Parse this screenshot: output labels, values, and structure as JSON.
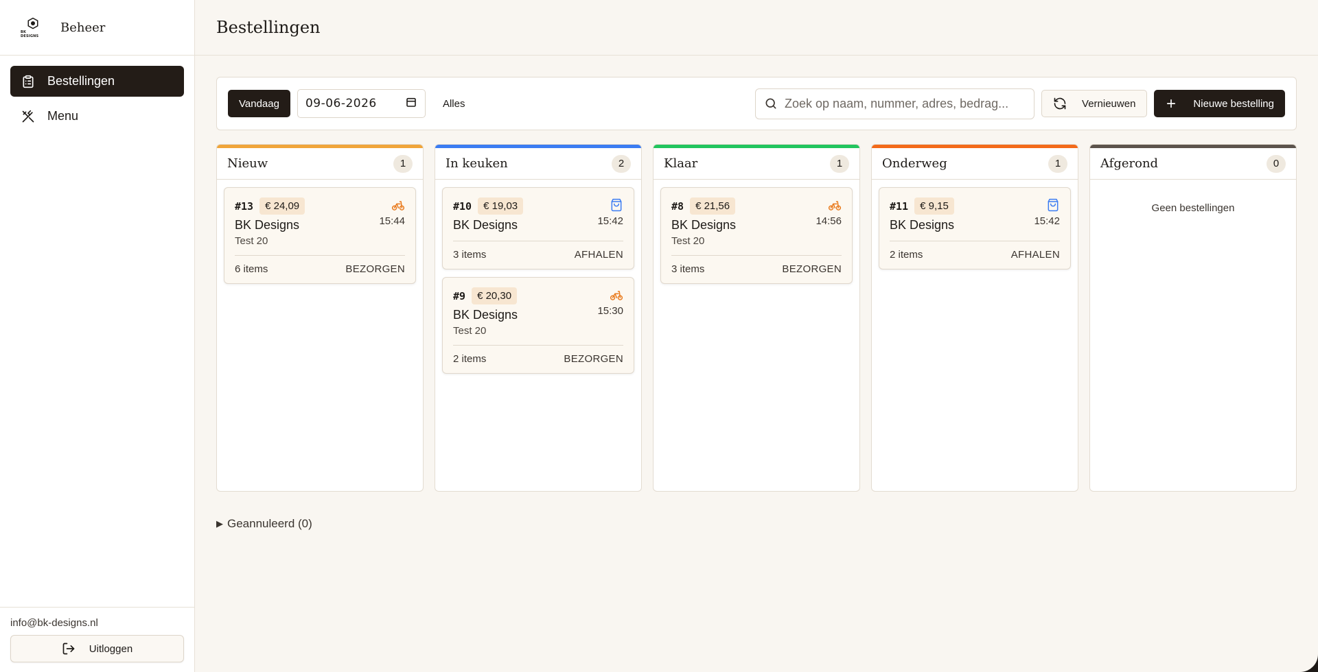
{
  "sidebar": {
    "brand_title": "Beheer",
    "logo_text": "BK DESIGNS",
    "nav": [
      {
        "label": "Bestellingen",
        "icon": "clipboard-icon",
        "active": true
      },
      {
        "label": "Menu",
        "icon": "utensils-icon",
        "active": false
      }
    ],
    "email": "info@bk-designs.nl",
    "logout_label": "Uitloggen"
  },
  "header": {
    "title": "Bestellingen"
  },
  "toolbar": {
    "today_label": "Vandaag",
    "date_value": "09-06-2026",
    "all_label": "Alles",
    "search_placeholder": "Zoek op naam, nummer, adres, bedrag...",
    "refresh_label": "Vernieuwen",
    "new_order_label": "Nieuwe bestelling"
  },
  "colors": {
    "nieuw": "#f0a53a",
    "in_keuken": "#3b7cf2",
    "klaar": "#22c55e",
    "onderweg": "#f36a1a",
    "afgerond": "#5c534c",
    "delivery_icon": "#e97a1c",
    "pickup_icon": "#3b7cf2"
  },
  "columns": [
    {
      "title": "Nieuw",
      "count": "1",
      "cards": [
        {
          "number": "#13",
          "price": "€ 24,09",
          "icon": "bike-icon",
          "time": "15:44",
          "name": "BK Designs",
          "sub": "Test 20",
          "items": "6 items",
          "type": "BEZORGEN"
        }
      ]
    },
    {
      "title": "In keuken",
      "count": "2",
      "cards": [
        {
          "number": "#10",
          "price": "€ 19,03",
          "icon": "bag-icon",
          "time": "15:42",
          "name": "BK Designs",
          "sub": "",
          "items": "3 items",
          "type": "AFHALEN"
        },
        {
          "number": "#9",
          "price": "€ 20,30",
          "icon": "bike-icon",
          "time": "15:30",
          "name": "BK Designs",
          "sub": "Test 20",
          "items": "2 items",
          "type": "BEZORGEN"
        }
      ]
    },
    {
      "title": "Klaar",
      "count": "1",
      "cards": [
        {
          "number": "#8",
          "price": "€ 21,56",
          "icon": "bike-icon",
          "time": "14:56",
          "name": "BK Designs",
          "sub": "Test 20",
          "items": "3 items",
          "type": "BEZORGEN"
        }
      ]
    },
    {
      "title": "Onderweg",
      "count": "1",
      "cards": [
        {
          "number": "#11",
          "price": "€ 9,15",
          "icon": "bag-icon",
          "time": "15:42",
          "name": "BK Designs",
          "sub": "",
          "items": "2 items",
          "type": "AFHALEN"
        }
      ]
    },
    {
      "title": "Afgerond",
      "count": "0",
      "empty_text": "Geen bestellingen",
      "cards": []
    }
  ],
  "cancelled_label": "Geannuleerd (0)"
}
